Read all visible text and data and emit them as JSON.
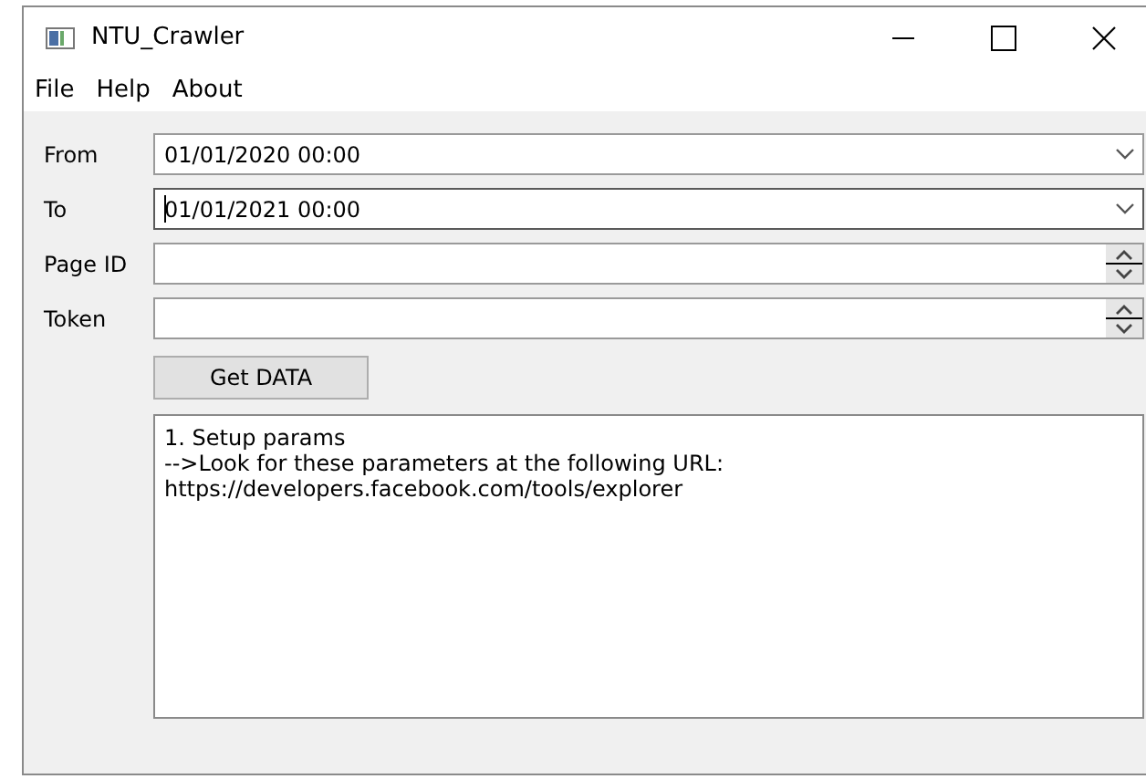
{
  "window": {
    "title": "NTU_Crawler"
  },
  "menu": [
    "File",
    "Help",
    "About"
  ],
  "fields": [
    {
      "label": "From",
      "kind": "date",
      "value": "01/01/2020 00:00",
      "focused": false
    },
    {
      "label": "To",
      "kind": "date",
      "value": "01/01/2021 00:00",
      "focused": true
    },
    {
      "label": "Page ID",
      "kind": "spin",
      "focused": false
    },
    {
      "label": "Token",
      "kind": "spin",
      "focused": false
    }
  ],
  "button": "Get DATA",
  "log": [
    "1. Setup params",
    "-->Look for these parameters at the following URL:",
    "https://developers.facebook.com/tools/explorer"
  ]
}
